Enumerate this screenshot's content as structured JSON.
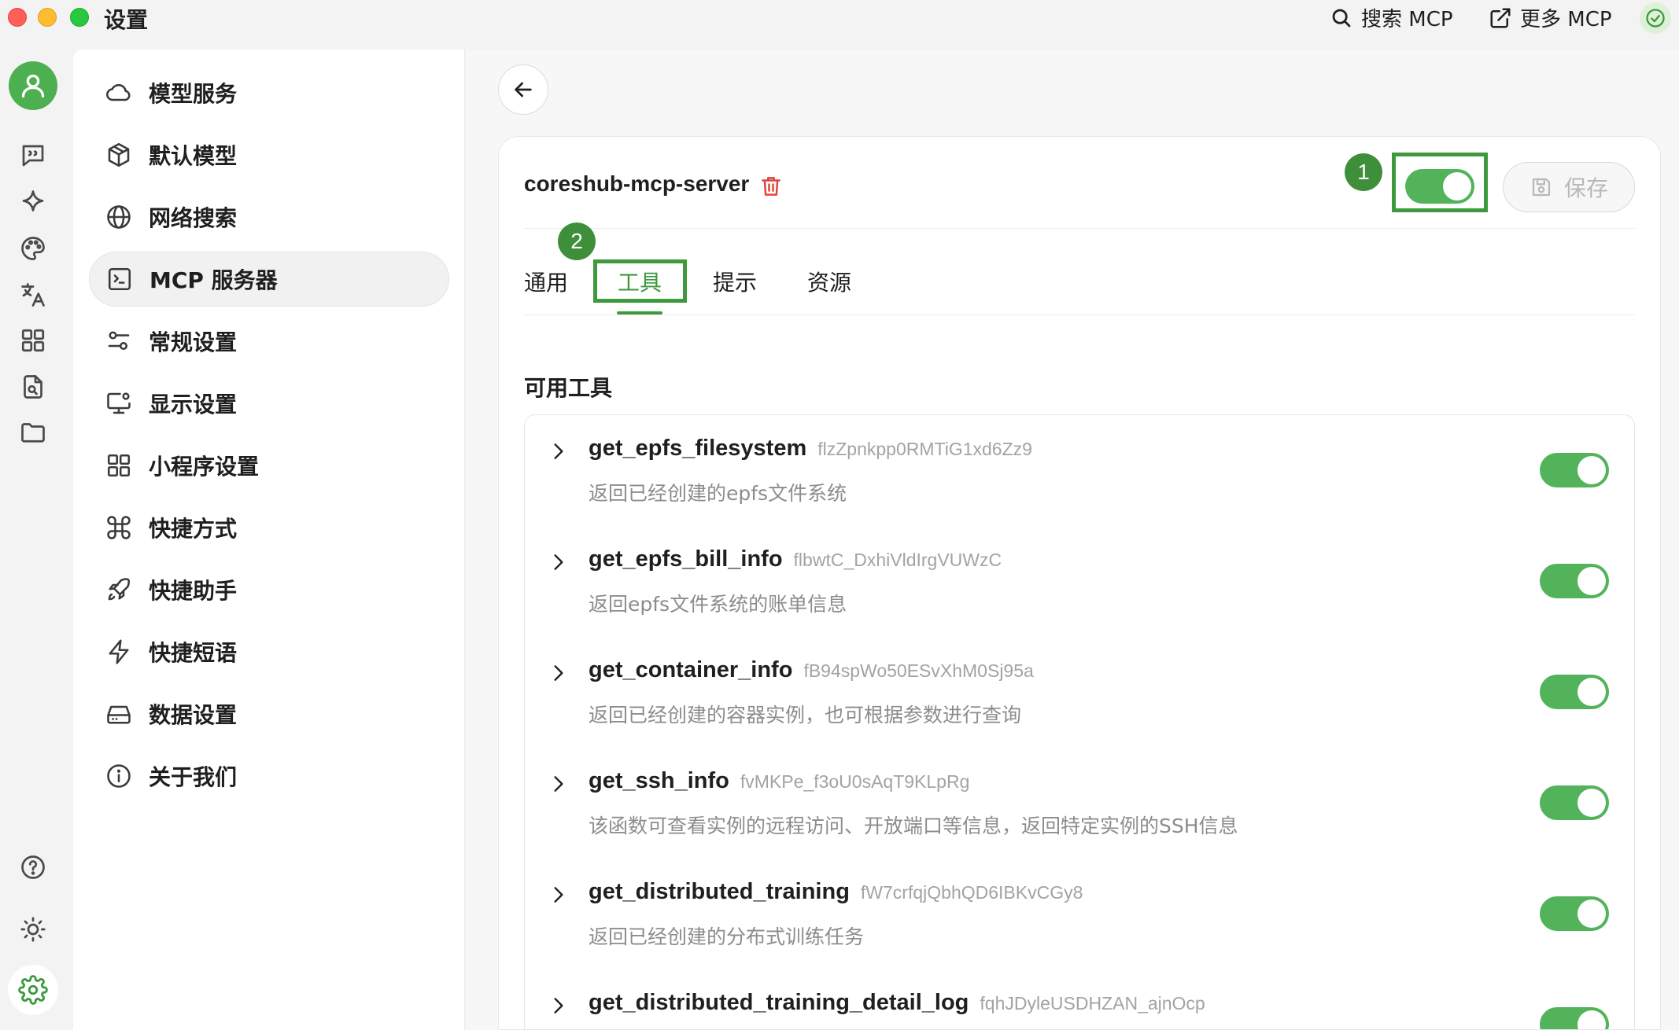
{
  "window": {
    "title": "设置",
    "search_mcp": "搜索 MCP",
    "more_mcp": "更多 MCP"
  },
  "menu": {
    "items": [
      {
        "label": "模型服务",
        "icon": "cloud-icon"
      },
      {
        "label": "默认模型",
        "icon": "cube-icon"
      },
      {
        "label": "网络搜索",
        "icon": "globe-icon"
      },
      {
        "label": "MCP 服务器",
        "icon": "terminal-icon"
      },
      {
        "label": "常规设置",
        "icon": "sliders-icon"
      },
      {
        "label": "显示设置",
        "icon": "monitor-settings-icon"
      },
      {
        "label": "小程序设置",
        "icon": "grid-icon"
      },
      {
        "label": "快捷方式",
        "icon": "command-icon"
      },
      {
        "label": "快捷助手",
        "icon": "rocket-icon"
      },
      {
        "label": "快捷短语",
        "icon": "lightning-icon"
      },
      {
        "label": "数据设置",
        "icon": "drive-icon"
      },
      {
        "label": "关于我们",
        "icon": "info-icon"
      }
    ],
    "active_index": 3
  },
  "server": {
    "name": "coreshub-mcp-server",
    "enabled": true,
    "save_label": "保存"
  },
  "badges": {
    "one": "1",
    "two": "2"
  },
  "tabs": [
    {
      "label": "通用"
    },
    {
      "label": "工具"
    },
    {
      "label": "提示"
    },
    {
      "label": "资源"
    }
  ],
  "active_tab": "工具",
  "tools_section": {
    "title": "可用工具",
    "tools": [
      {
        "name": "get_epfs_filesystem",
        "id": "flzZpnkpp0RMTiG1xd6Zz9",
        "desc": "返回已经创建的epfs文件系统",
        "enabled": true
      },
      {
        "name": "get_epfs_bill_info",
        "id": "flbwtC_DxhiVldIrgVUWzC",
        "desc": "返回epfs文件系统的账单信息",
        "enabled": true
      },
      {
        "name": "get_container_info",
        "id": "fB94spWo50ESvXhM0Sj95a",
        "desc": "返回已经创建的容器实例，也可根据参数进行查询",
        "enabled": true
      },
      {
        "name": "get_ssh_info",
        "id": "fvMKPe_f3oU0sAqT9KLpRg",
        "desc": "该函数可查看实例的远程访问、开放端口等信息，返回特定实例的SSH信息",
        "enabled": true
      },
      {
        "name": "get_distributed_training",
        "id": "fW7crfqjQbhQD6IBKvCGy8",
        "desc": "返回已经创建的分布式训练任务",
        "enabled": true
      },
      {
        "name": "get_distributed_training_detail_log",
        "id": "fqhJDyleUSDHZAN_ajnOcp",
        "desc": "",
        "enabled": true
      }
    ]
  },
  "colors": {
    "accent": "#52b35a",
    "highlight": "#3c9a3c",
    "badge": "#3f8f3a"
  }
}
